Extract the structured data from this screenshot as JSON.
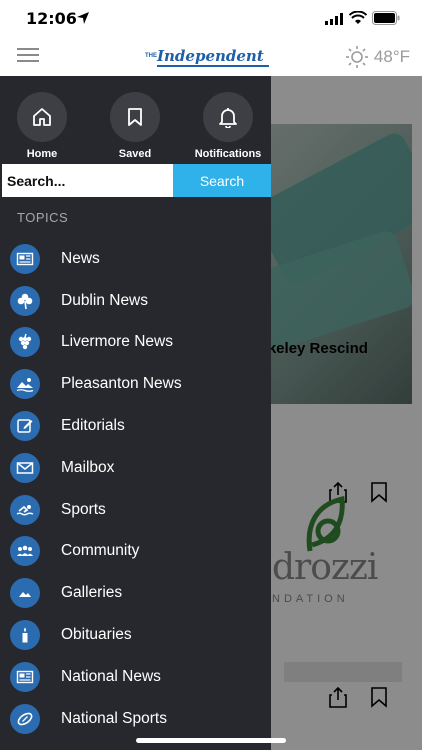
{
  "status_bar": {
    "time": "12:06"
  },
  "header": {
    "logo_prefix": "THE",
    "logo_name": "Independent",
    "weather": "48°F"
  },
  "background": {
    "headline": "rkeley Rescind",
    "sponsor_name": "drozzi",
    "sponsor_sub": "NDATION"
  },
  "drawer": {
    "quick_actions": [
      {
        "label": "Home",
        "icon": "home-icon"
      },
      {
        "label": "Saved",
        "icon": "bookmark-icon"
      },
      {
        "label": "Notifications",
        "icon": "bell-icon"
      }
    ],
    "search": {
      "placeholder": "Search...",
      "button_label": "Search"
    },
    "topics_heading": "TOPICS",
    "topics": [
      {
        "label": "News",
        "icon": "newspaper-icon"
      },
      {
        "label": "Dublin News",
        "icon": "shamrock-icon"
      },
      {
        "label": "Livermore News",
        "icon": "grapes-icon"
      },
      {
        "label": "Pleasanton News",
        "icon": "landscape-icon"
      },
      {
        "label": "Editorials",
        "icon": "edit-icon"
      },
      {
        "label": "Mailbox",
        "icon": "envelope-icon"
      },
      {
        "label": "Sports",
        "icon": "swimmer-icon"
      },
      {
        "label": "Community",
        "icon": "people-icon"
      },
      {
        "label": "Galleries",
        "icon": "image-icon"
      },
      {
        "label": "Obituaries",
        "icon": "candle-icon"
      },
      {
        "label": "National News",
        "icon": "newspaper-icon"
      },
      {
        "label": "National Sports",
        "icon": "football-icon"
      }
    ]
  },
  "colors": {
    "drawer_bg": "#26282e",
    "accent": "#2fb1e9",
    "topic_icon": "#2b6cb0",
    "brand": "#1d5fa8"
  }
}
